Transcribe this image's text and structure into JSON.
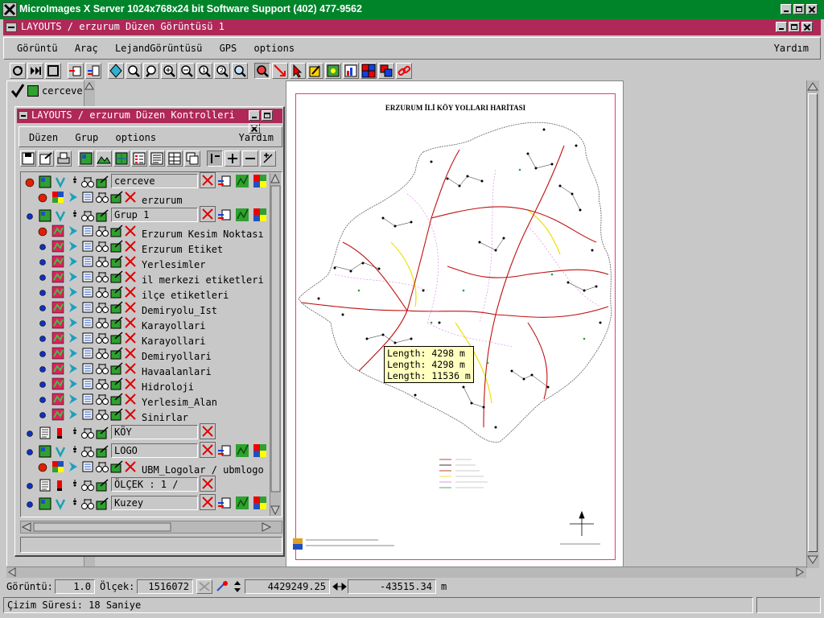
{
  "title_bar": {
    "title": "MicroImages X Server  1024x768x24 bit  Software Support (402) 477-9562"
  },
  "layout_window": {
    "title": "LAYOUTS / erzurum  Düzen Görüntüsü 1",
    "menu": [
      "Görüntü",
      "Araç",
      "LejandGörüntüsü",
      "GPS",
      "options"
    ],
    "help": "Yardım"
  },
  "legend_peek": {
    "items": [
      "cerceve"
    ]
  },
  "controls_window": {
    "title": "LAYOUTS / erzurum  Düzen Kontrolleri",
    "menu": [
      "Düzen",
      "Grup",
      "options"
    ],
    "help": "Yardım",
    "rows": [
      {
        "kind": "group",
        "label": "cerceve",
        "dot": "red"
      },
      {
        "kind": "layer",
        "label": "erzurum",
        "dot": "red",
        "icon": "raster"
      },
      {
        "kind": "group",
        "label": "Grup 1",
        "dot": "blue"
      },
      {
        "kind": "layer",
        "label": "Erzurum Kesim Noktası",
        "dot": "red",
        "icon": "vector"
      },
      {
        "kind": "layer",
        "label": "Erzurum Etiket",
        "dot": "blue",
        "icon": "vector"
      },
      {
        "kind": "layer",
        "label": "Yerlesimler",
        "dot": "blue",
        "icon": "vector"
      },
      {
        "kind": "layer",
        "label": "il merkezi etiketleri",
        "dot": "blue",
        "icon": "vector"
      },
      {
        "kind": "layer",
        "label": "ilçe etiketleri",
        "dot": "blue",
        "icon": "vector"
      },
      {
        "kind": "layer",
        "label": "Demiryolu_Ist",
        "dot": "blue",
        "icon": "vector"
      },
      {
        "kind": "layer",
        "label": "Karayollari",
        "dot": "blue",
        "icon": "vector"
      },
      {
        "kind": "layer",
        "label": "Karayollari",
        "dot": "blue",
        "icon": "vector"
      },
      {
        "kind": "layer",
        "label": "Demiryollari",
        "dot": "blue",
        "icon": "vector"
      },
      {
        "kind": "layer",
        "label": "Havaalanlari",
        "dot": "blue",
        "icon": "vector"
      },
      {
        "kind": "layer",
        "label": "Hidroloji",
        "dot": "blue",
        "icon": "vector"
      },
      {
        "kind": "layer",
        "label": "Yerlesim_Alan",
        "dot": "blue",
        "icon": "vector"
      },
      {
        "kind": "layer",
        "label": "Sinirlar",
        "dot": "blue",
        "icon": "vector"
      },
      {
        "kind": "text",
        "label": "KÖY HİZMETLE...",
        "dot": "blue"
      },
      {
        "kind": "group",
        "label": "LOGO",
        "dot": "blue"
      },
      {
        "kind": "layer",
        "label": "UBM_Logolar / ubmlogo",
        "dot": "red",
        "icon": "raster"
      },
      {
        "kind": "text",
        "label": "ÖLÇEK : 1 / ...",
        "dot": "blue"
      },
      {
        "kind": "group",
        "label": "Kuzey",
        "dot": "blue"
      }
    ]
  },
  "map": {
    "title": "ERZURUM İLİ KÖY YOLLARI HARİTASI",
    "tooltip": [
      "Length: 4298 m",
      "Length: 4298 m",
      "Length: 11536 m"
    ]
  },
  "status": {
    "view_label": "Görüntü:",
    "view_value": "1.0",
    "scale_label": "Ölçek:",
    "scale_value": "1516072",
    "x_value": "4429249.25",
    "y_value": "-43515.34",
    "unit": "m",
    "message": "Çizim Süresi: 18 Saniye"
  },
  "colors": {
    "title_bar": "#00842a",
    "layout_title": "#b02858",
    "dialog_title": "#b02858",
    "road": "#c01010",
    "highlight": "#ffff00"
  }
}
